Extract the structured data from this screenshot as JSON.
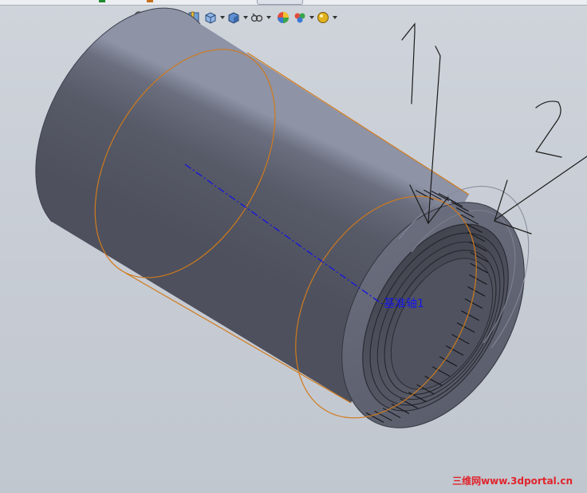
{
  "toolbar": {
    "buttons": [
      {
        "icon": "zoom-to-fit-icon",
        "dropdown": false
      },
      {
        "icon": "zoom-to-area-icon",
        "dropdown": false
      },
      {
        "icon": "previous-view-icon",
        "dropdown": false
      },
      {
        "icon": "section-view-icon",
        "dropdown": false
      },
      {
        "icon": "view-orientation-icon",
        "dropdown": true
      },
      {
        "icon": "display-style-icon",
        "dropdown": true
      },
      {
        "icon": "hide-show-items-icon",
        "dropdown": true
      },
      {
        "icon": "edit-appearance-icon",
        "dropdown": false
      },
      {
        "icon": "apply-scene-icon",
        "dropdown": true
      },
      {
        "icon": "view-settings-icon",
        "dropdown": true
      }
    ]
  },
  "annotations": {
    "axis_label": "基准轴1",
    "callout_1": "1",
    "callout_2": "2"
  },
  "watermark": "三维网www.3dportal.cn",
  "colors": {
    "viewport_background": "#c9ced6",
    "part_body": "#5a5d6a",
    "silhouette_edge": "#d07a1c",
    "axis_line": "#1414e0",
    "annotation_ink": "#1a1a1a",
    "watermark": "#e0242c"
  }
}
